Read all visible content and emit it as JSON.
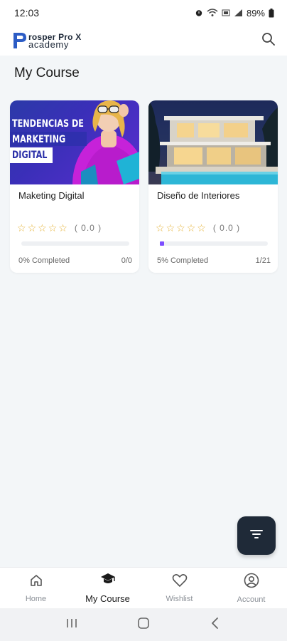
{
  "status_bar": {
    "time": "12:03",
    "battery": "89%"
  },
  "app_bar": {
    "logo_line1": "rosper Pro X",
    "logo_line2": "academy",
    "logo_letter": "P"
  },
  "page": {
    "title": "My Course"
  },
  "courses": [
    {
      "title": "Maketing Digital",
      "thumbnail_text": [
        "TENDENCIAS DE",
        "MARKETING",
        "DIGITAL"
      ],
      "rating_count": "( 0.0 )",
      "progress_fraction": 0,
      "progress_text": "0% Completed",
      "lessons": "0/0"
    },
    {
      "title": "Diseño de Interiores",
      "rating_count": "( 0.0 )",
      "progress_fraction": 0.05,
      "progress_text": "5% Completed",
      "lessons": "1/21"
    }
  ],
  "bottom_nav": [
    {
      "label": "Home",
      "icon": "home-icon"
    },
    {
      "label": "My Course",
      "icon": "graduation-cap-icon"
    },
    {
      "label": "Wishlist",
      "icon": "heart-icon"
    },
    {
      "label": "Account",
      "icon": "account-icon"
    }
  ],
  "colors": {
    "accent": "#7c4dff",
    "fab": "#1f2a38",
    "star": "#e5b339",
    "background": "#f3f6f8"
  }
}
